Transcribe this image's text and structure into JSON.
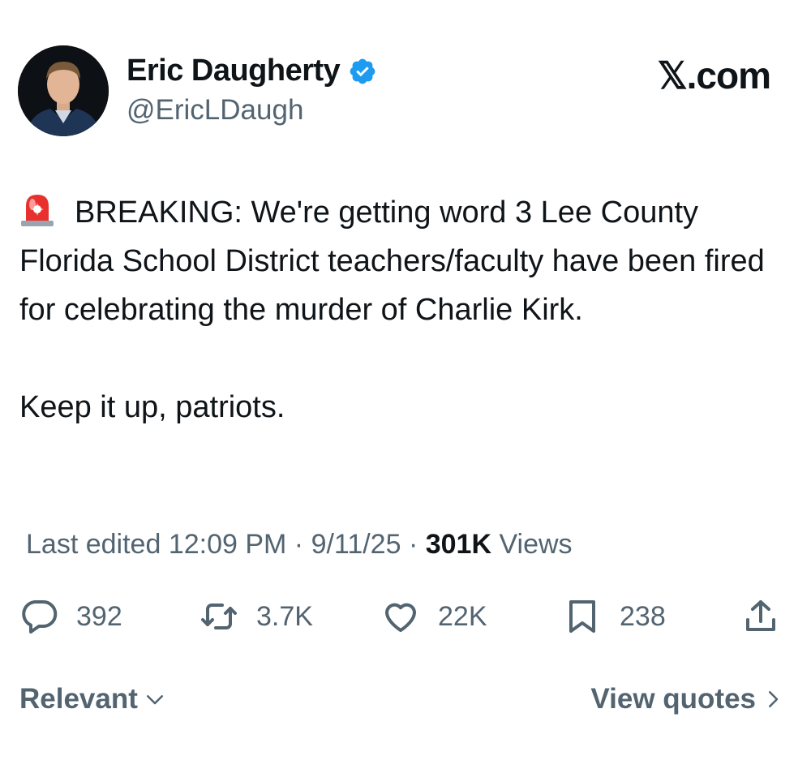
{
  "author": {
    "display_name": "Eric Daugherty",
    "handle": "@EricLDaugh",
    "verified_icon": "verified-badge-icon",
    "verified_color": "#1d9bf0"
  },
  "brand": {
    "label": "𝕏.com"
  },
  "tweet": {
    "emoji_icon": "police-siren-icon",
    "body": "BREAKING: We're getting word 3 Lee County Florida School District teachers/faculty have been fired for celebrating the murder of Charlie Kirk.\n\nKeep it up, patriots."
  },
  "meta": {
    "edited_label": "Last edited",
    "time": "12:09 PM",
    "separator": "·",
    "date": "9/11/25",
    "views_count": "301K",
    "views_label": "Views"
  },
  "actions": {
    "replies": {
      "icon": "reply-icon",
      "count": "392"
    },
    "reposts": {
      "icon": "repost-icon",
      "count": "3.7K"
    },
    "likes": {
      "icon": "heart-icon",
      "count": "22K"
    },
    "bookmarks": {
      "icon": "bookmark-icon",
      "count": "238"
    },
    "share": {
      "icon": "share-icon"
    }
  },
  "footer": {
    "sort_label": "Relevant",
    "quotes_label": "View quotes"
  },
  "colors": {
    "text": "#0f1419",
    "secondary": "#536471",
    "accent": "#1d9bf0"
  }
}
